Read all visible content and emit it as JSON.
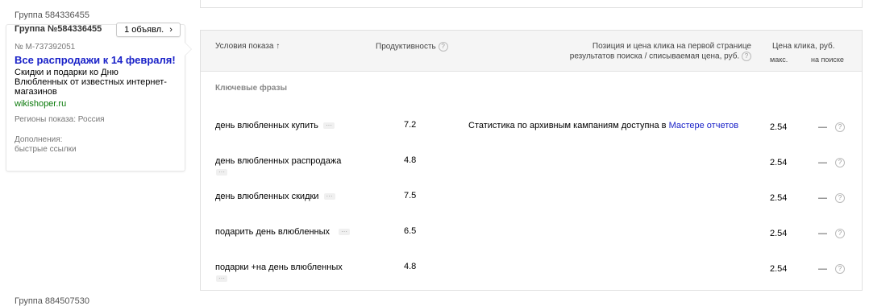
{
  "left": {
    "group_caption_top": "Группа 584336455",
    "group_title": "Группа №584336455",
    "ads_button_label": "1 объявл.",
    "ads_button_chevron": "›",
    "ad": {
      "number": "№ М-737392051",
      "headline": "Все распродажи к 14 февраля!",
      "text_line1": "Скидки и подарки ко Дню",
      "text_line2": "Влюбленных от известных интернет-",
      "text_line3": "магазинов",
      "domain": "wikishoper.ru",
      "regions": "Регионы показа: Россия",
      "extras_label": "Дополнения:",
      "extras_value": "быстрые ссылки"
    },
    "group_caption_bottom": "Группа 884507530"
  },
  "table": {
    "headers": {
      "conditions": "Условия показа",
      "conditions_sort": "↑",
      "productivity": "Продуктивность",
      "position_line1": "Позиция и цена клика на первой странице",
      "position_line2": "результатов поиска / списываемая цена, руб.",
      "price": "Цена клика, руб.",
      "price_max": "макс.",
      "price_search": "на поиске"
    },
    "section_label": "Ключевые фразы",
    "stats_text": "Статистика по архивным кампаниям доступна в ",
    "stats_link": "Мастере отчетов",
    "dots": "···",
    "qmark": "?",
    "rows": [
      {
        "phrase": "день влюбленных купить",
        "productivity": "7.2",
        "max": "2.54",
        "search": "—"
      },
      {
        "phrase": "день влюбленных распродажа",
        "productivity": "4.8",
        "max": "2.54",
        "search": "—"
      },
      {
        "phrase": "день влюбленных скидки",
        "productivity": "7.5",
        "max": "2.54",
        "search": "—"
      },
      {
        "phrase": "подарить день влюбленных",
        "productivity": "6.5",
        "max": "2.54",
        "search": "—"
      },
      {
        "phrase": "подарки +на день влюбленных",
        "productivity": "4.8",
        "max": "2.54",
        "search": "—"
      }
    ]
  }
}
